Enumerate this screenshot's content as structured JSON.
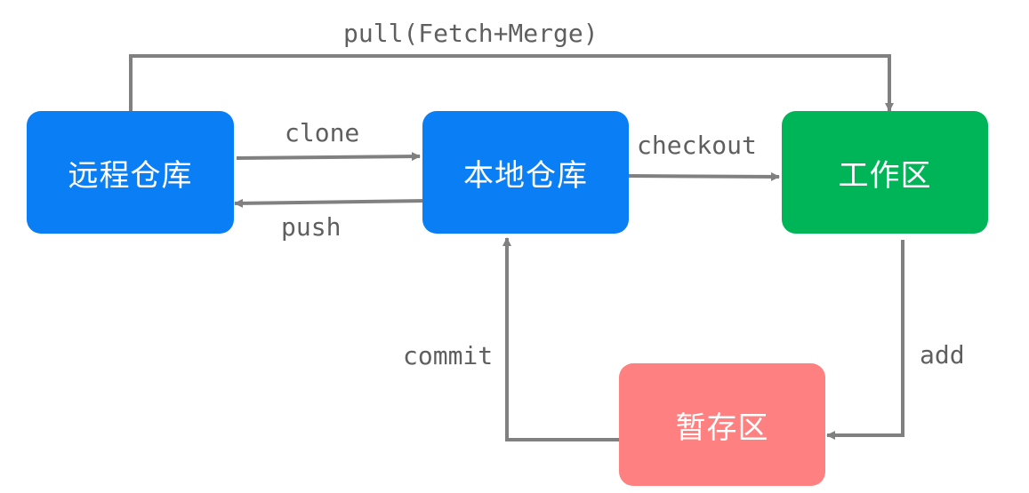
{
  "colors": {
    "repo_blue": "#0a7ff5",
    "work_green": "#00b558",
    "stage_red": "#ff8080",
    "arrow_gray": "#808080",
    "label_gray": "#5f5f5f"
  },
  "nodes": {
    "remote": "远程仓库",
    "local": "本地仓库",
    "workspace": "工作区",
    "staging": "暂存区"
  },
  "edges": {
    "pull": "pull(Fetch+Merge)",
    "clone": "clone",
    "push": "push",
    "checkout": "checkout",
    "add": "add",
    "commit": "commit"
  }
}
